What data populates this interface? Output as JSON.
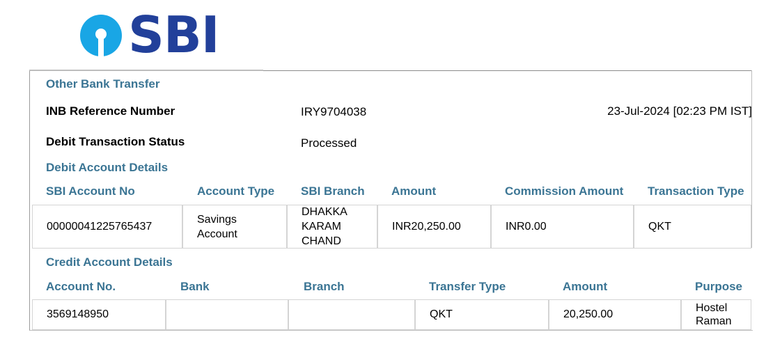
{
  "logo": {
    "text": "SBI",
    "brand_color": "#22409a",
    "icon_color": "#19a6e5"
  },
  "section_title": "Other Bank Transfer",
  "summary": {
    "ref_label": "INB Reference Number",
    "ref_value": "IRY9704038",
    "datetime": "23-Jul-2024 [02:23 PM IST]",
    "status_label": "Debit Transaction Status",
    "status_value": "Processed"
  },
  "debit": {
    "title": "Debit Account Details",
    "headers": [
      "SBI Account No",
      "Account Type",
      "SBI Branch",
      "Amount",
      "Commission Amount",
      "Transaction Type"
    ],
    "row": {
      "account_no": "00000041225765437",
      "account_type": "Savings Account",
      "branch": "DHAKKA KARAM CHAND",
      "amount": "INR20,250.00",
      "commission": "INR0.00",
      "transaction_type": "QKT"
    }
  },
  "credit": {
    "title": "Credit Account Details",
    "headers": [
      "Account No.",
      "Bank",
      "Branch",
      "Transfer Type",
      "Amount",
      "Purpose"
    ],
    "row": {
      "account_no": "3569148950",
      "bank": "",
      "branch": "",
      "transfer_type": "QKT",
      "amount": "20,250.00",
      "purpose": "Hostel Raman"
    }
  },
  "colors": {
    "section_heading": "#3b7594",
    "border": "#d4d4d4"
  }
}
